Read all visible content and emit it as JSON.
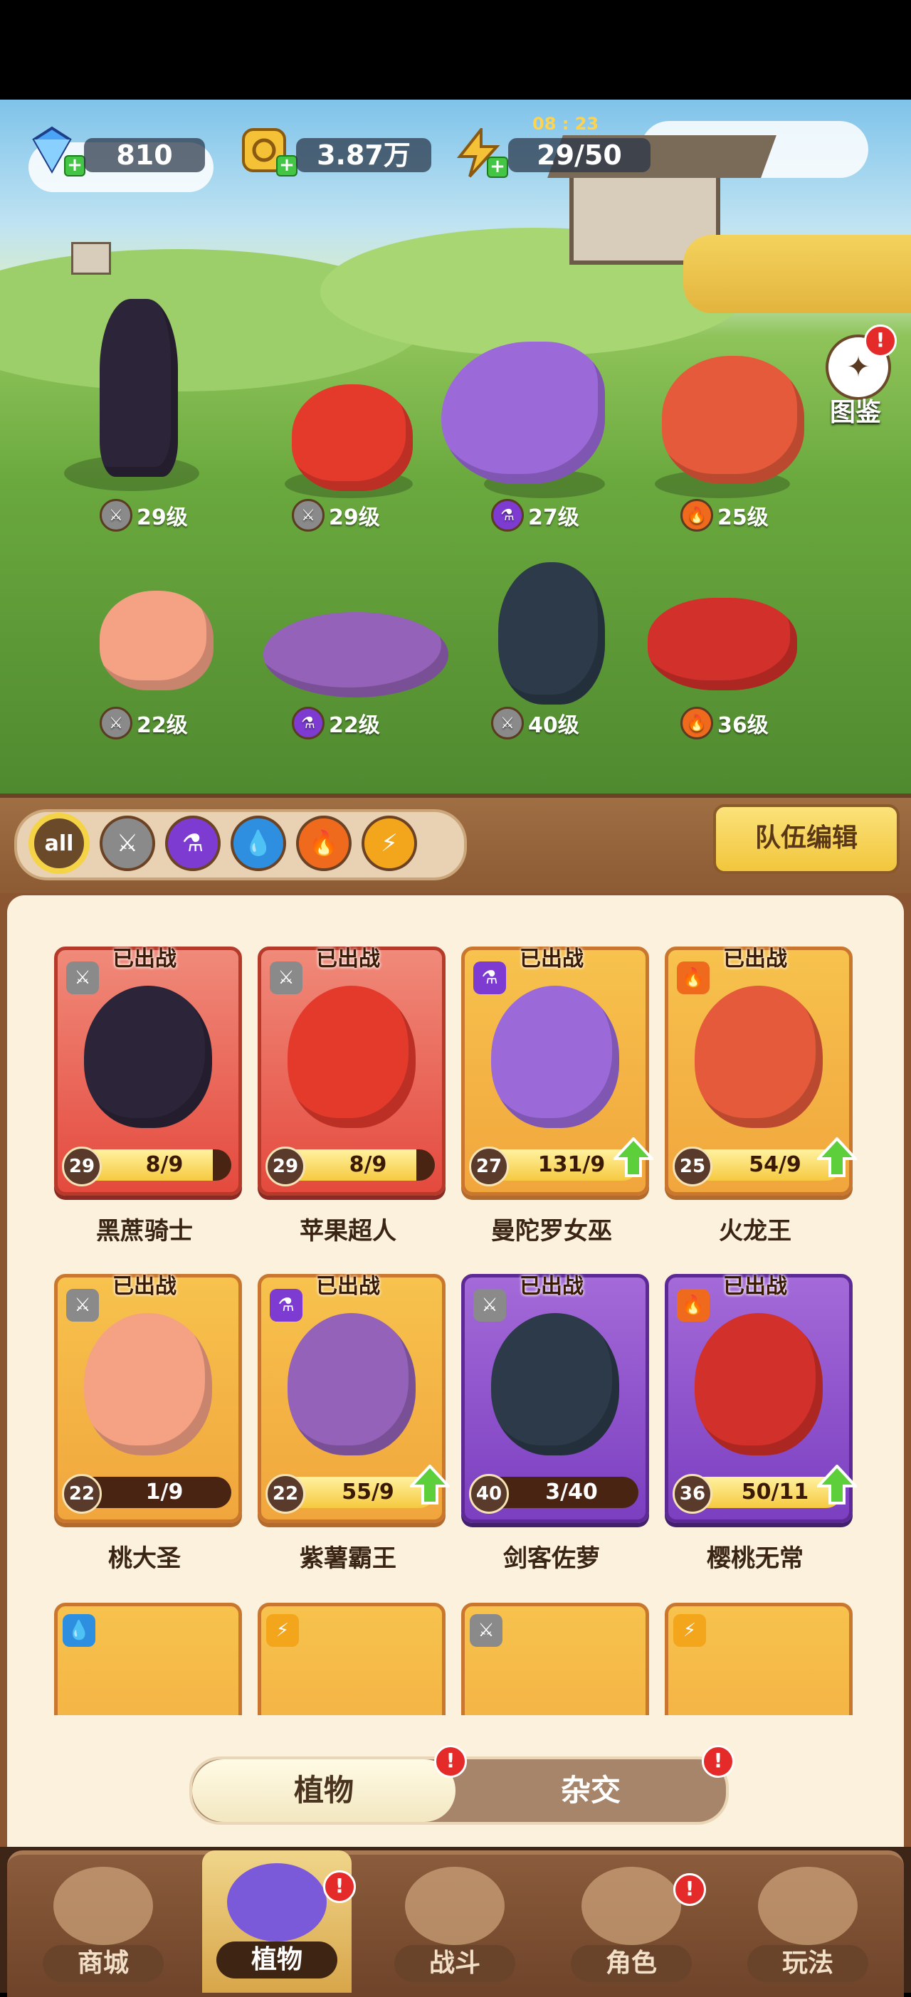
{
  "currency": {
    "gems": "810",
    "coins": "3.87万",
    "energy": "29/50",
    "energy_timer": "08 : 23",
    "plus": "+"
  },
  "atlas": {
    "label": "图鉴",
    "badge": "!"
  },
  "field": [
    {
      "level": "29级",
      "element": "sword"
    },
    {
      "level": "29级",
      "element": "sword"
    },
    {
      "level": "27级",
      "element": "potion"
    },
    {
      "level": "25级",
      "element": "fire"
    },
    {
      "level": "22级",
      "element": "sword"
    },
    {
      "level": "22级",
      "element": "potion"
    },
    {
      "level": "40级",
      "element": "sword"
    },
    {
      "level": "36级",
      "element": "fire"
    }
  ],
  "filter": {
    "all_label": "all",
    "team_edit": "队伍编辑"
  },
  "cards": [
    {
      "name": "黑蔗骑士",
      "level": "29",
      "progress": "8/9",
      "fill": 0.89,
      "banner": "已出战",
      "element": "sword",
      "upgrade": false
    },
    {
      "name": "苹果超人",
      "level": "29",
      "progress": "8/9",
      "fill": 0.89,
      "banner": "已出战",
      "element": "sword",
      "upgrade": false
    },
    {
      "name": "曼陀罗女巫",
      "level": "27",
      "progress": "131/9",
      "fill": 1.0,
      "banner": "已出战",
      "element": "potion",
      "upgrade": true
    },
    {
      "name": "火龙王",
      "level": "25",
      "progress": "54/9",
      "fill": 1.0,
      "banner": "已出战",
      "element": "fire",
      "upgrade": true
    },
    {
      "name": "桃大圣",
      "level": "22",
      "progress": "1/9",
      "fill": 0.11,
      "banner": "已出战",
      "element": "sword",
      "upgrade": false
    },
    {
      "name": "紫薯霸王",
      "level": "22",
      "progress": "55/9",
      "fill": 1.0,
      "banner": "已出战",
      "element": "potion",
      "upgrade": true
    },
    {
      "name": "剑客佐萝",
      "level": "40",
      "progress": "3/40",
      "fill": 0.08,
      "banner": "已出战",
      "element": "sword",
      "upgrade": false
    },
    {
      "name": "樱桃无常",
      "level": "36",
      "progress": "50/11",
      "fill": 1.0,
      "banner": "已出战",
      "element": "fire",
      "upgrade": true
    }
  ],
  "tabs": {
    "plants": "植物",
    "hybrid": "杂交",
    "badge": "!"
  },
  "nav": [
    "商城",
    "植物",
    "战斗",
    "角色",
    "玩法"
  ]
}
